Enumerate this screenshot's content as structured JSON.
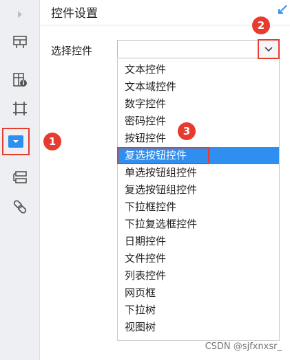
{
  "panel": {
    "title": "控件设置"
  },
  "field": {
    "label": "选择控件",
    "value": ""
  },
  "dropdown": {
    "options": [
      "文本控件",
      "文本域控件",
      "数字控件",
      "密码控件",
      "按钮控件",
      "复选按钮控件",
      "单选按钮组控件",
      "复选按钮组控件",
      "下拉框控件",
      "下拉复选框控件",
      "日期控件",
      "文件控件",
      "列表控件",
      "网页框",
      "下拉树",
      "视图树"
    ],
    "selected": "复选按钮控件"
  },
  "sidebar": {
    "items": [
      {
        "icon": "collapse-arrow-icon"
      },
      {
        "icon": "layout-grid-icon"
      },
      {
        "icon": "widget-info-icon"
      },
      {
        "icon": "crop-frame-icon"
      },
      {
        "icon": "control-widget-icon",
        "active": true
      },
      {
        "icon": "layer-stack-icon"
      },
      {
        "icon": "link-icon"
      }
    ]
  },
  "annotations": {
    "badge1": "1",
    "badge2": "2",
    "badge3": "3"
  },
  "colors": {
    "accent": "#2f8ff0",
    "annotation": "#e63b2e",
    "sidebar_bg": "#eeeff2"
  },
  "watermark": "CSDN @sjfxnxsr_"
}
